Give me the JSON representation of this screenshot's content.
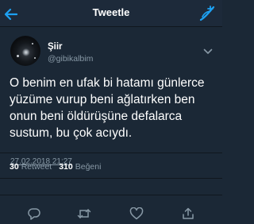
{
  "header": {
    "title": "Tweetle"
  },
  "tweet": {
    "display_name": "Şiir",
    "handle": "@gibikalbim",
    "text_lines": [
      "O benim en ufak bi hatamı günlerce",
      "yüzüme vurup beni ağlatırken ben",
      "onun beni öldürüşüne defalarca",
      "sustum, bu çok acıydı."
    ],
    "timestamp": "27.02.2018 21:27",
    "retweet_count": "30",
    "retweet_label": "Retweet",
    "like_count": "310",
    "like_label": "Beğeni"
  },
  "colors": {
    "background": "#1b2836",
    "accent": "#1da1f2",
    "muted": "#8899a6"
  },
  "icons": {
    "back": "back-arrow-icon",
    "compose": "compose-tweet-icon",
    "menu": "chevron-down-icon",
    "reply": "reply-icon",
    "retweet": "retweet-icon",
    "like": "heart-icon",
    "share": "share-icon"
  }
}
